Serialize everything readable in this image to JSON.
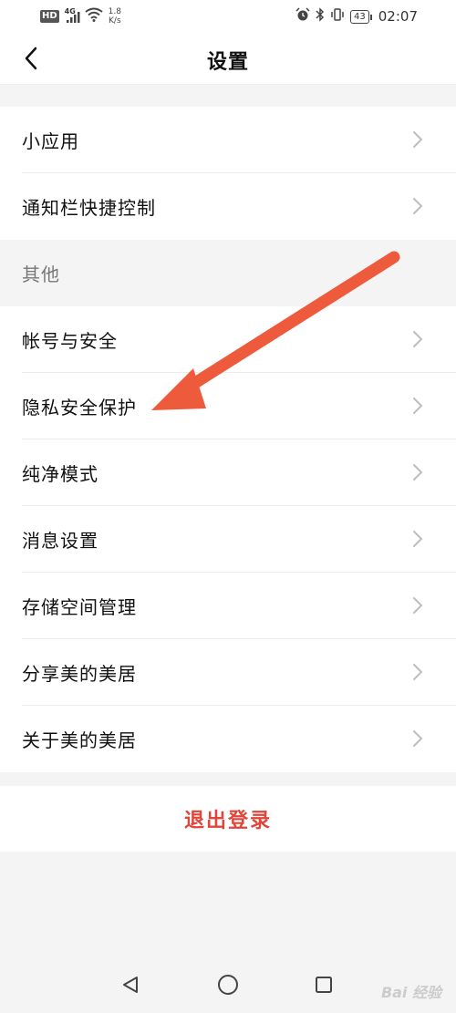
{
  "status_bar": {
    "hd": "HD",
    "network": "4G",
    "speed_value": "1.8",
    "speed_unit": "K/s",
    "battery": "43",
    "time": "02:07"
  },
  "header": {
    "title": "设置"
  },
  "section1": [
    {
      "label": "小应用"
    },
    {
      "label": "通知栏快捷控制"
    }
  ],
  "group2": {
    "header": "其他",
    "items": [
      {
        "label": "帐号与安全"
      },
      {
        "label": "隐私安全保护"
      },
      {
        "label": "纯净模式"
      },
      {
        "label": "消息设置"
      },
      {
        "label": "存储空间管理"
      },
      {
        "label": "分享美的美居"
      },
      {
        "label": "关于美的美居"
      }
    ]
  },
  "logout": {
    "label": "退出登录"
  },
  "watermark": "Bai 经验",
  "colors": {
    "accent_red": "#e0453a",
    "annotation_arrow": "#ee5a3c",
    "background": "#f4f4f4"
  }
}
